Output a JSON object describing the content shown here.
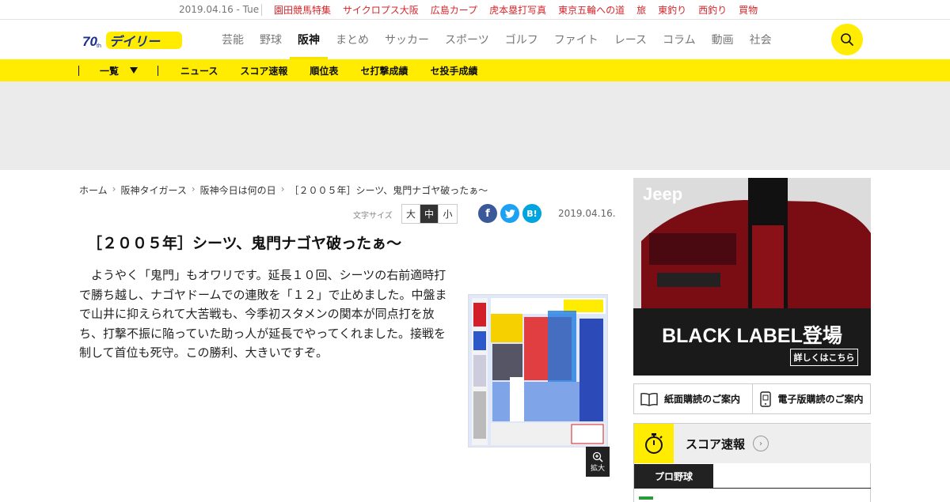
{
  "topbar": {
    "date": "2019.04.16 - Tue",
    "links": [
      "園田競馬特集",
      "サイクロプス大阪",
      "広島カープ",
      "虎本塁打写真",
      "東京五輪への道",
      "旅",
      "東釣り",
      "西釣り",
      "買物"
    ]
  },
  "header": {
    "logo_text": "デイリー",
    "nav": [
      {
        "label": "芸能",
        "active": false
      },
      {
        "label": "野球",
        "active": false
      },
      {
        "label": "阪神",
        "active": true
      },
      {
        "label": "まとめ",
        "active": false
      },
      {
        "label": "サッカー",
        "active": false
      },
      {
        "label": "スポーツ",
        "active": false
      },
      {
        "label": "ゴルフ",
        "active": false
      },
      {
        "label": "ファイト",
        "active": false
      },
      {
        "label": "レース",
        "active": false
      },
      {
        "label": "コラム",
        "active": false
      },
      {
        "label": "動画",
        "active": false
      },
      {
        "label": "社会",
        "active": false
      }
    ],
    "search_icon": "search-icon"
  },
  "subnav": {
    "ichiran": "一覧",
    "items": [
      "ニュース",
      "スコア速報",
      "順位表",
      "セ打撃成績",
      "セ投手成績"
    ]
  },
  "breadcrumb": [
    "ホーム",
    "阪神タイガース",
    "阪神今日は何の日",
    "［２００５年］シーツ、鬼門ナゴヤ破ったぁ～"
  ],
  "article": {
    "font_size_label": "文字サイズ",
    "font_sizes": [
      "大",
      "中",
      "小"
    ],
    "font_size_selected": "中",
    "share": {
      "facebook": "f",
      "twitter": "t",
      "hatena": "B!"
    },
    "date": "2019.04.16.",
    "title": "［２００５年］シーツ、鬼門ナゴヤ破ったぁ～",
    "body": "ようやく「鬼門」もオワリです。延長１０回、シーツの右前適時打で勝ち越し、ナゴヤドームでの連敗を「１２」で止めました。中盤まで山井に抑えられて大苦戦も、今季初スタメンの関本が同点打を放ち、打撃不振に陥っていた助っ人が延長でやってくれました。接戦を制して首位も死守。この勝利、大きいですぞ。",
    "zoom_label": "拡大"
  },
  "sidebar": {
    "ad": {
      "brand": "Jeep",
      "headline": "BLACK LABEL登場",
      "button": "詳しくはこちら"
    },
    "subscriptions": [
      "紙面購読のご案内",
      "電子版購読のご案内"
    ],
    "score": {
      "title": "スコア速報",
      "tab": "プロ野球"
    }
  }
}
